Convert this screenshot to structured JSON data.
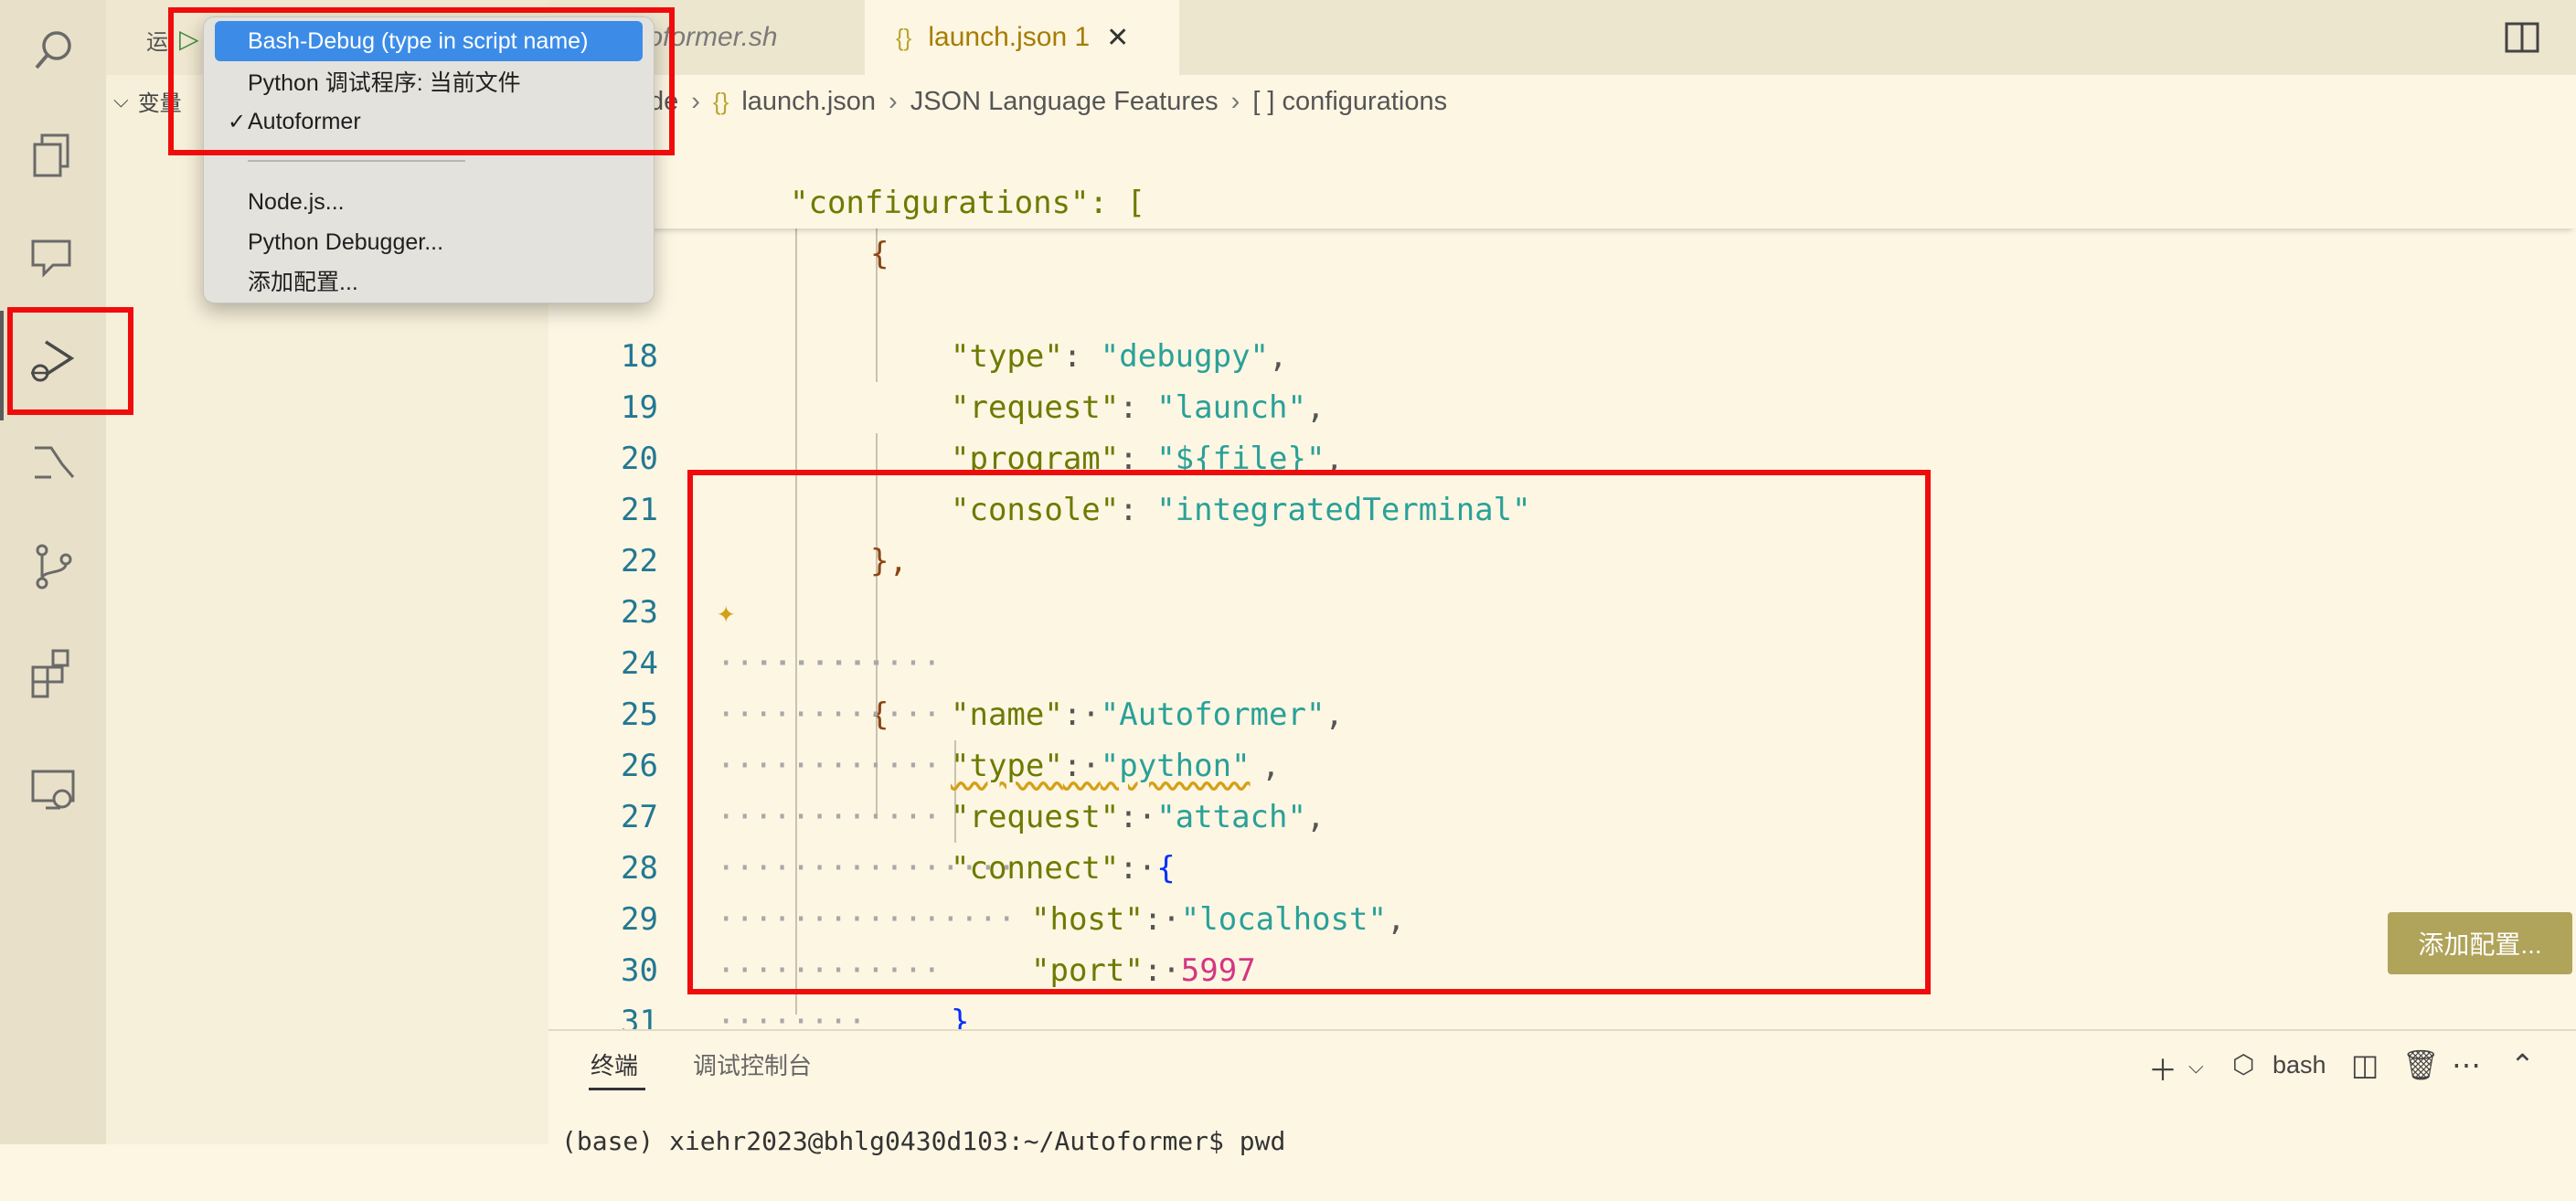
{
  "sidebar": {
    "run_label": "运",
    "variables_label": "变量"
  },
  "tabs": [
    {
      "label": "toformer.sh"
    },
    {
      "label": "launch.json 1"
    }
  ],
  "tab_launch_icon": "{}",
  "breadcrumb": {
    "first": "de",
    "file": "launch.json",
    "section": "JSON Language Features",
    "node": "[ ] configurations"
  },
  "dropdown": {
    "items": [
      {
        "label": "Bash-Debug (type in script name)",
        "selected": true,
        "checked": false
      },
      {
        "label": "Python 调试程序: 当前文件",
        "selected": false,
        "checked": false
      },
      {
        "label": "Autoformer",
        "selected": false,
        "checked": true
      },
      {
        "label": "Node.js...",
        "selected": false,
        "checked": false
      },
      {
        "label": "Python Debugger...",
        "selected": false,
        "checked": false
      },
      {
        "label": "添加配置...",
        "selected": false,
        "checked": false
      }
    ]
  },
  "editor": {
    "sticky_line1": "\"configurations\": [",
    "sticky_line2": "{",
    "lines": [
      {
        "no": "",
        "key": "\"type\"",
        "val": "\"debugpy\"",
        "tail": ","
      },
      {
        "no": "18",
        "key": "\"request\"",
        "val": "\"launch\"",
        "tail": ","
      },
      {
        "no": "19",
        "key": "\"program\"",
        "val": "\"${file}\"",
        "tail": ","
      },
      {
        "no": "20",
        "key": "\"console\"",
        "val": "\"integratedTerminal\"",
        "tail": ""
      },
      {
        "no": "21",
        "text": "},"
      },
      {
        "no": "22",
        "text": "{"
      },
      {
        "no": "23",
        "key": "\"name\"",
        "val": "\"Autoformer\"",
        "tail": ","
      },
      {
        "no": "24",
        "key": "\"type\"",
        "val": "\"python\"",
        "tail": ","
      },
      {
        "no": "25",
        "key": "\"request\"",
        "val": "\"attach\"",
        "tail": ","
      },
      {
        "no": "26",
        "key": "\"connect\"",
        "val": "{",
        "tail": ""
      },
      {
        "no": "27",
        "key": "\"host\"",
        "val": "\"localhost\"",
        "tail": ","
      },
      {
        "no": "28",
        "key": "\"port\"",
        "val": "5997",
        "tail": ""
      },
      {
        "no": "29",
        "text": "}"
      },
      {
        "no": "30",
        "text": "},"
      },
      {
        "no": "31",
        "text": "]"
      },
      {
        "no": "32",
        "text": "}"
      }
    ]
  },
  "add_config_label": "添加配置...",
  "panel": {
    "tab_terminal": "终端",
    "tab_debug_console": "调试控制台",
    "shell_label": "bash",
    "terminal_text": "(base) xiehr2023@bhlg0430d103:~/Autoformer$ pwd"
  },
  "colors": {
    "highlight_red": "#f00c0c",
    "selection_blue": "#3c8ce7",
    "add_button": "#b0a35a"
  }
}
